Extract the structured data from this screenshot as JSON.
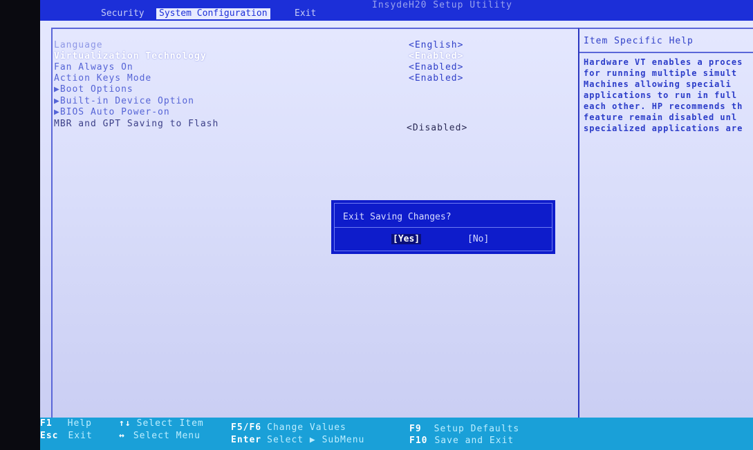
{
  "bios": {
    "title": "InsydeH20 Setup Utility"
  },
  "menu": {
    "tabs": [
      {
        "label": "Security",
        "active": false
      },
      {
        "label": "System Configuration",
        "active": true
      },
      {
        "label": "Exit",
        "active": false
      }
    ]
  },
  "settings": [
    {
      "label": "Language",
      "value": "<English>"
    },
    {
      "label": "Virtualization Technology",
      "value": "<Enabled>"
    },
    {
      "label": "Fan Always On",
      "value": "<Enabled>"
    },
    {
      "label": "Action Keys Mode",
      "value": "<Enabled>"
    },
    {
      "label": "▶Boot Options",
      "value": ""
    },
    {
      "label": "▶Built-in Device Option",
      "value": ""
    },
    {
      "label": "▶BIOS Auto Power-on",
      "value": ""
    },
    {
      "label": "MBR and GPT Saving to Flash",
      "value": "<Disabled>"
    }
  ],
  "help": {
    "title": "Item Specific Help",
    "lines": [
      "Hardware VT enables a proces",
      "for running multiple simult",
      "Machines allowing speciali",
      "applications to run in full",
      "each other. HP recommends th",
      "feature remain disabled unl",
      "specialized applications are"
    ]
  },
  "dialog": {
    "title": "Exit Saving Changes?",
    "yes_label": "[Yes]",
    "no_label": "[No]"
  },
  "keys": [
    {
      "key": "F1",
      "desc": "Help"
    },
    {
      "key": "Esc",
      "desc": "Exit"
    },
    {
      "key": "↑↓",
      "desc": "Select Item"
    },
    {
      "key": "↔",
      "desc": "Select Menu"
    },
    {
      "key": "F5/F6",
      "desc": "Change Values"
    },
    {
      "key": "Enter",
      "desc": "Select ▶ SubMenu"
    },
    {
      "key": "F9",
      "desc": "Setup Defaults"
    },
    {
      "key": "F10",
      "desc": "Save and Exit"
    }
  ],
  "colors": {
    "bar_blue": "#1c2fd8",
    "dialog_blue": "#0e1ccb",
    "legend_cyan": "#1aa0d8",
    "panel_bg": "#dfe2fc"
  }
}
